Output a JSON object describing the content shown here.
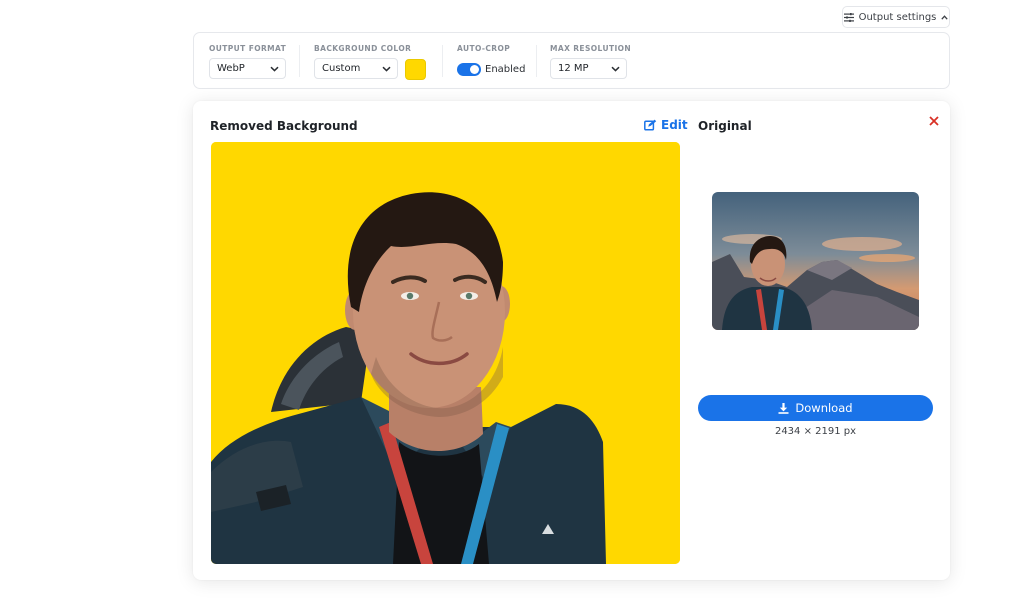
{
  "header": {
    "output_settings_label": "Output settings"
  },
  "settings": {
    "output_format": {
      "label": "OUTPUT FORMAT",
      "value": "WebP"
    },
    "background_color": {
      "label": "BACKGROUND COLOR",
      "value": "Custom",
      "swatch": "#ffd800"
    },
    "auto_crop": {
      "label": "AUTO-CROP",
      "state": "Enabled",
      "on": true
    },
    "max_resolution": {
      "label": "MAX RESOLUTION",
      "value": "12 MP"
    }
  },
  "card": {
    "removed_title": "Removed Background",
    "edit_label": "Edit",
    "original_title": "Original",
    "download_label": "Download",
    "dimensions": "2434 × 2191 px"
  },
  "colors": {
    "accent": "#1a73e8",
    "background_fill": "#ffd800",
    "close": "#d93025"
  }
}
